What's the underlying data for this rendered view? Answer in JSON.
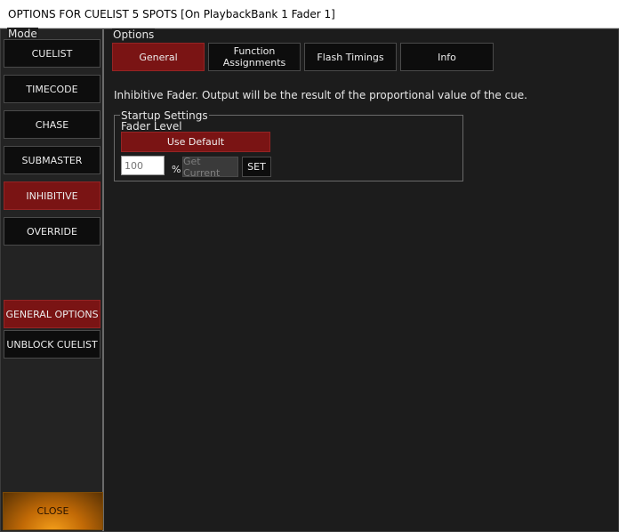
{
  "window": {
    "title": "OPTIONS FOR CUELIST 5 SPOTS  [On PlaybackBank 1 Fader 1]"
  },
  "mode": {
    "label": "Mode",
    "buttons": [
      {
        "label": "CUELIST",
        "active": false
      },
      {
        "label": "TIMECODE",
        "active": false
      },
      {
        "label": "CHASE",
        "active": false
      },
      {
        "label": "SUBMASTER",
        "active": false
      },
      {
        "label": "INHIBITIVE",
        "active": true
      },
      {
        "label": "OVERRIDE",
        "active": false
      }
    ],
    "general_options_label": "GENERAL OPTIONS",
    "unblock_cuelist_label": "UNBLOCK CUELIST",
    "close_label": "CLOSE"
  },
  "options": {
    "label": "Options",
    "tabs": [
      {
        "label": "General",
        "active": true
      },
      {
        "label": "Function Assignments",
        "active": false
      },
      {
        "label": "Flash Timings",
        "active": false
      },
      {
        "label": "Info",
        "active": false
      }
    ],
    "description": "Inhibitive Fader. Output will be the result of the proportional value of the cue.",
    "startup": {
      "legend": "Startup Settings",
      "fader_level_label": "Fader Level",
      "use_default_label": "Use Default",
      "value_placeholder": "100",
      "percent_symbol": "%",
      "get_current_label": "Get Current",
      "set_label": "SET"
    }
  },
  "colors": {
    "background": "#1c1c1c",
    "button_dark": "#0d0d0d",
    "active_red": "#7a1414",
    "close_orange": "#f7a21c"
  }
}
